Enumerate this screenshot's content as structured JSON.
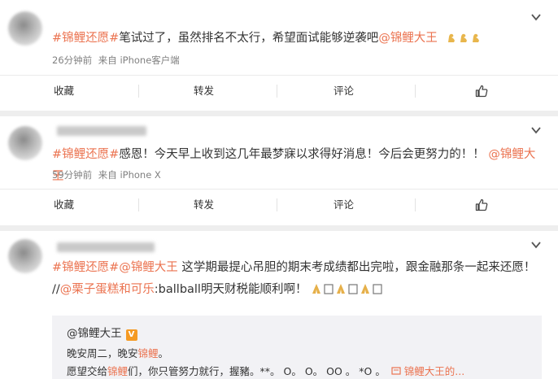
{
  "posts": [
    {
      "tag": "#锦鲤还愿#",
      "body": "笔试过了，虽然排名不太行，希望面试能够逆袭吧",
      "mention": "@锦鲤大王",
      "emoji_icon": "muscle-emoji",
      "time": "26分钟前",
      "source": "来自 iPhone客户端",
      "actions": [
        "收藏",
        "转发",
        "评论"
      ]
    },
    {
      "tag": "#锦鲤还愿#",
      "body": "感恩！今天早上收到这几年最梦寐以求得好消息！今后会更努力的！！",
      "mention": "@锦鲤大王",
      "time": "59分钟前",
      "source": "来自 iPhone X",
      "actions": [
        "收藏",
        "转发",
        "评论"
      ]
    },
    {
      "tag": "#锦鲤还愿#",
      "mention": "@锦鲤大王",
      "body": "这学期最提心吊胆的期末考成绩都出完啦，跟金融那条一起来还愿！",
      "repost_sep": "//",
      "mention2": "@栗子蛋糕和可乐",
      "body2": ":ballball明天财税能顺利啊！",
      "emoji_icon": "pray-emoji",
      "quote": {
        "author": "@锦鲤大王",
        "badge": "V",
        "line1": "晚安周二，晚安",
        "line1_link": "锦鲤",
        "line1_end": "。",
        "line2_start": "愿望交给",
        "line2_link": "锦鲤",
        "line2_mid": "们，你只管努力就行，握豬。**。 O。 O。 OO 。 *O 。",
        "line2_link2": "锦鲤大王的..."
      }
    }
  ],
  "colors": {
    "accent": "#eb7350",
    "link": "#eb7350",
    "meta": "#808080",
    "background": "#eeeeee"
  },
  "icons": {
    "chevron": "chevron-down-icon",
    "like": "thumbs-up-icon"
  }
}
